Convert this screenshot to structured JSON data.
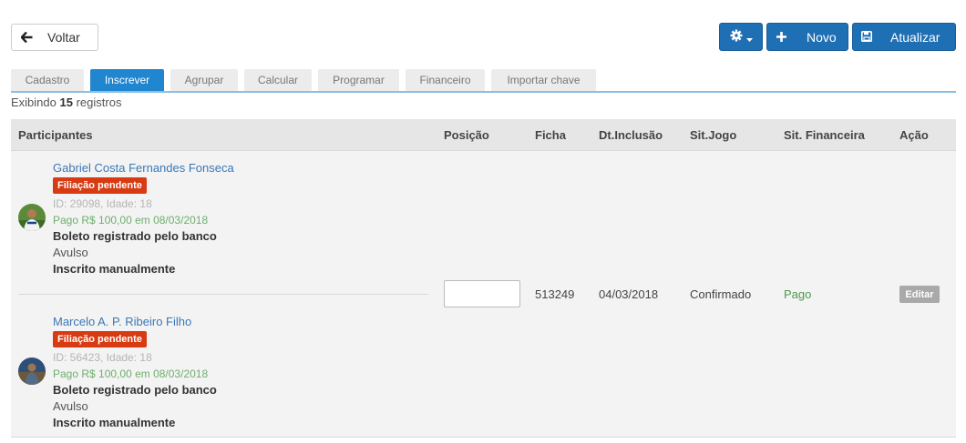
{
  "toolbar": {
    "back_label": "Voltar",
    "new_label": "Novo",
    "update_label": "Atualizar",
    "back_icon": "arrow-left-icon",
    "gear_icon": "gear-icon",
    "plus_icon": "plus-icon",
    "save_icon": "save-icon"
  },
  "tabs": [
    {
      "label": "Cadastro",
      "active": false
    },
    {
      "label": "Inscrever",
      "active": true
    },
    {
      "label": "Agrupar",
      "active": false
    },
    {
      "label": "Calcular",
      "active": false
    },
    {
      "label": "Programar",
      "active": false
    },
    {
      "label": "Financeiro",
      "active": false
    },
    {
      "label": "Importar chave",
      "active": false
    }
  ],
  "summary": {
    "prefix": "Exibindo",
    "count": "15",
    "suffix": "registros"
  },
  "table": {
    "headers": {
      "participants": "Participantes",
      "position": "Posição",
      "ficha": "Ficha",
      "dt_inclusao": "Dt.Inclusão",
      "sit_jogo": "Sit.Jogo",
      "sit_financeira": "Sit. Financeira",
      "acao": "Ação"
    },
    "rows": [
      {
        "participants": [
          {
            "name": "Gabriel Costa Fernandes Fonseca",
            "badge": "Filiação pendente",
            "id_age": "ID: 29098, Idade: 18",
            "payment": "Pago R$ 100,00 em 08/03/2018",
            "boleto": "Boleto registrado pelo banco",
            "type": "Avulso",
            "inscription": "Inscrito manualmente"
          },
          {
            "name": "Marcelo A. P. Ribeiro Filho",
            "badge": "Filiação pendente",
            "id_age": "ID: 56423, Idade: 18",
            "payment": "Pago R$ 100,00 em 08/03/2018",
            "boleto": "Boleto registrado pelo banco",
            "type": "Avulso",
            "inscription": "Inscrito manualmente"
          }
        ],
        "position_value": "",
        "ficha": "513249",
        "dt_inclusao": "04/03/2018",
        "sit_jogo": "Confirmado",
        "sit_financeira": "Pago",
        "action_label": "Editar"
      }
    ]
  },
  "colors": {
    "primary": "#1f6fb4",
    "tab_active": "#1f86cf",
    "badge": "#d83a12",
    "paid_green": "#4a9a4a",
    "link": "#3a78b5"
  }
}
